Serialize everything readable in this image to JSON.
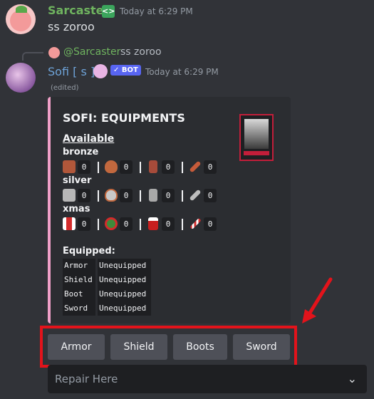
{
  "message1": {
    "username": "Sarcaster",
    "badge_icon": "dev-badge-icon",
    "timestamp": "Today at 6:29 PM",
    "text": "ss zoroo"
  },
  "reply": {
    "username": "@Sarcaster",
    "text": "ss zoroo"
  },
  "message2": {
    "username": "Sofi [ s ]",
    "bot_tag": "✓ BOT",
    "timestamp": "Today at 6:29 PM",
    "edited": "(edited)"
  },
  "embed": {
    "title": "SOFI: EQUIPMENTS",
    "accent_color": "#f0a0c8",
    "available_label": "Available",
    "tiers": [
      {
        "name": "bronze",
        "items": [
          {
            "icon": "bronze-armor-icon",
            "count": "0"
          },
          {
            "icon": "bronze-shield-icon",
            "count": "0"
          },
          {
            "icon": "bronze-boot-icon",
            "count": "0"
          },
          {
            "icon": "bronze-sword-icon",
            "count": "0"
          }
        ]
      },
      {
        "name": "silver",
        "items": [
          {
            "icon": "silver-armor-icon",
            "count": "0"
          },
          {
            "icon": "silver-shield-icon",
            "count": "0"
          },
          {
            "icon": "silver-boot-icon",
            "count": "0"
          },
          {
            "icon": "silver-sword-icon",
            "count": "0"
          }
        ]
      },
      {
        "name": "xmas",
        "items": [
          {
            "icon": "xmas-armor-icon",
            "count": "0"
          },
          {
            "icon": "xmas-shield-icon",
            "count": "0"
          },
          {
            "icon": "xmas-boot-icon",
            "count": "0"
          },
          {
            "icon": "xmas-sword-icon",
            "count": "0"
          }
        ]
      }
    ],
    "equipped_label": "Equipped:",
    "equipped": [
      {
        "slot": "Armor",
        "value": "Unequipped"
      },
      {
        "slot": "Shield",
        "value": "Unequipped"
      },
      {
        "slot": "Boot",
        "value": "Unequipped"
      },
      {
        "slot": "Sword",
        "value": "Unequipped"
      }
    ]
  },
  "buttons": [
    "Armor",
    "Shield",
    "Boots",
    "Sword"
  ],
  "select": {
    "placeholder": "Repair Here"
  },
  "highlight_color": "#e3131b"
}
